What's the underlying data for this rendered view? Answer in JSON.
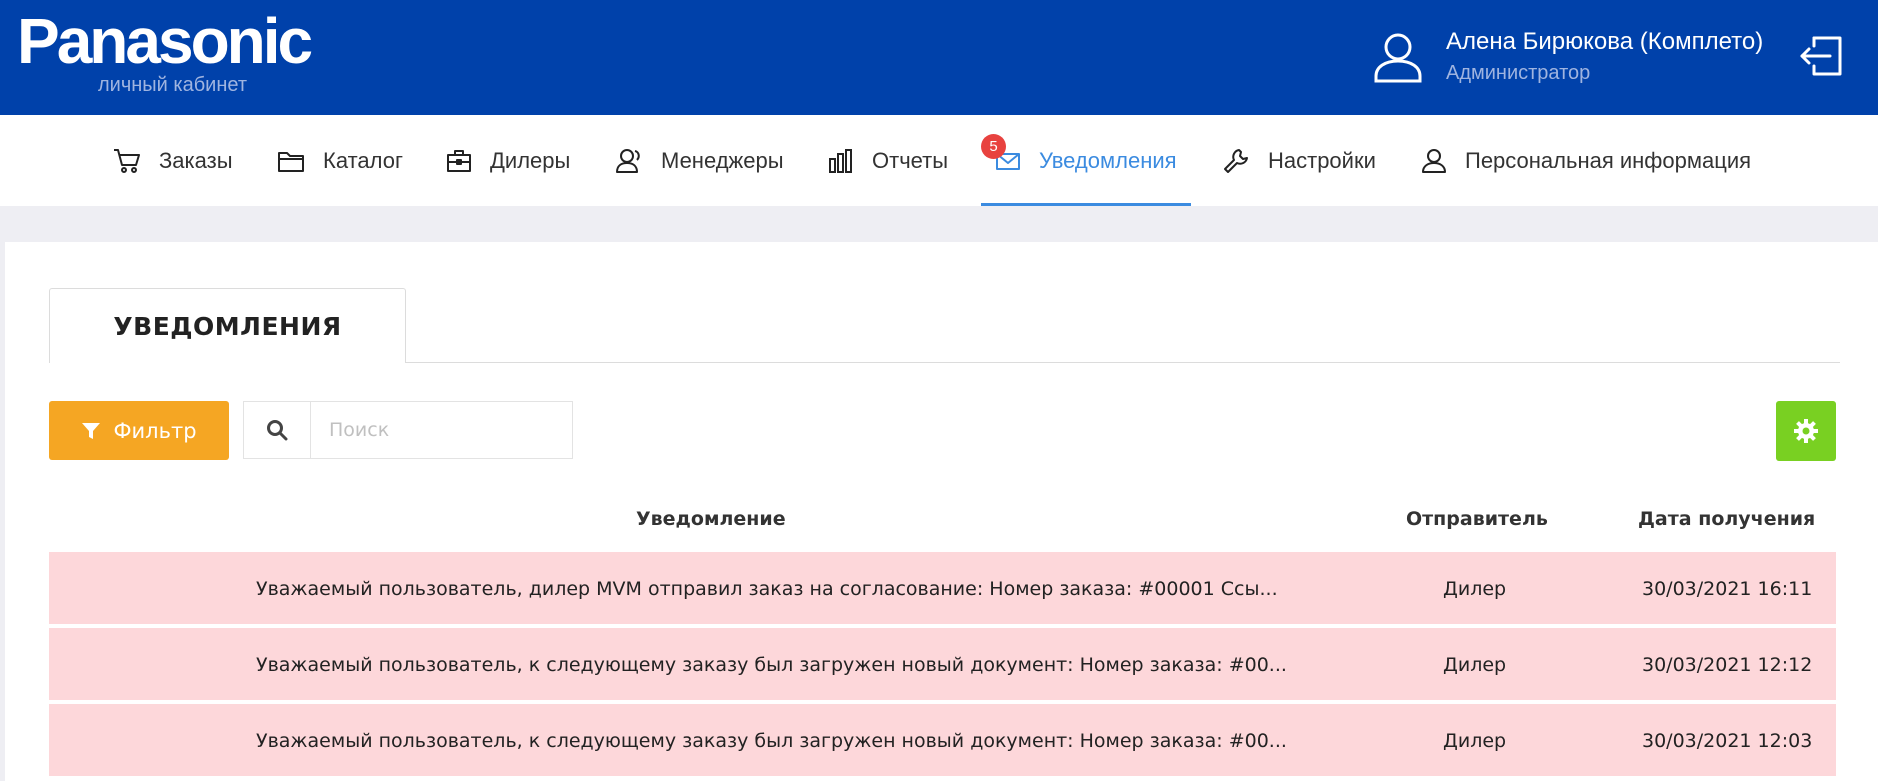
{
  "header": {
    "logo": "Panasonic",
    "logo_sub": "личный кабинет",
    "user_name": "Алена Бирюкова (Комплето)",
    "user_role": "Администратор",
    "bg_color": "#0041aa"
  },
  "nav": {
    "items": [
      {
        "label": "Заказы",
        "icon": "cart-icon"
      },
      {
        "label": "Каталог",
        "icon": "folder-icon"
      },
      {
        "label": "Дилеры",
        "icon": "briefcase-icon"
      },
      {
        "label": "Менеджеры",
        "icon": "managers-icon"
      },
      {
        "label": "Отчеты",
        "icon": "bar-chart-icon"
      },
      {
        "label": "Уведомления",
        "icon": "envelope-icon",
        "active": true,
        "badge": "5"
      },
      {
        "label": "Настройки",
        "icon": "wrench-icon"
      },
      {
        "label": "Персональная информация",
        "icon": "user-icon"
      }
    ],
    "active_color": "#3b8be0"
  },
  "main": {
    "tab_title": "УВЕДОМЛЕНИЯ",
    "filter_label": "Фильтр",
    "search_placeholder": "Поиск",
    "columns": [
      "Уведомление",
      "Отправитель",
      "Дата получения"
    ],
    "rows": [
      {
        "text": "Уважаемый пользователь, дилер MVM отправил заказ на согласование: Номер заказа: #00001 Ссы...",
        "sender": "Дилер",
        "date": "30/03/2021 16:11"
      },
      {
        "text": "Уважаемый пользователь, к следующему заказу был загружен новый документ: Номер заказа: #00...",
        "sender": "Дилер",
        "date": "30/03/2021 12:12"
      },
      {
        "text": "Уважаемый пользователь, к следующему заказу был загружен новый документ: Номер заказа: #00...",
        "sender": "Дилер",
        "date": "30/03/2021 12:03"
      }
    ],
    "unread_row_color": "#fdd7da",
    "filter_color": "#f5a623",
    "settings_color": "#79d022"
  }
}
